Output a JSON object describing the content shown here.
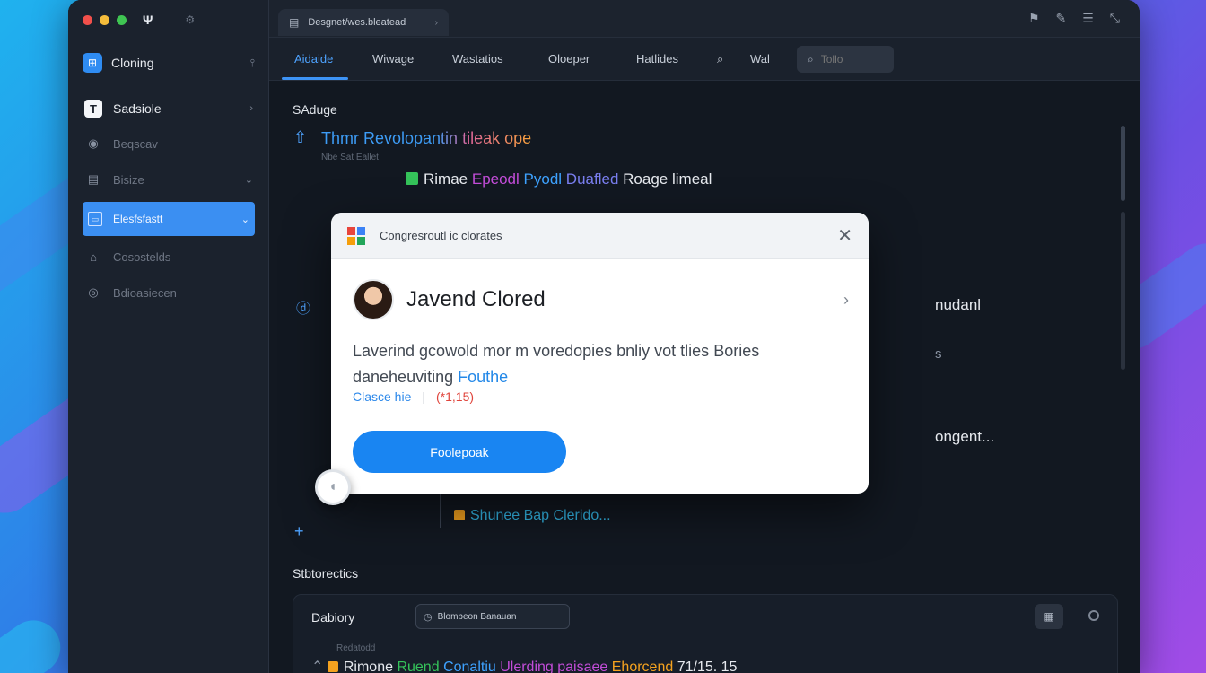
{
  "window": {
    "title_short": "Ψ",
    "doc_tab": "Desgnet/wes.bleatead"
  },
  "sidebar": {
    "app_name": "Cloning",
    "items": [
      {
        "label": "Sadsiole",
        "icon": "document-icon",
        "chevron": "›"
      },
      {
        "label": "Beqscav",
        "icon": "user-icon",
        "chevron": ""
      },
      {
        "label": "Bisize",
        "icon": "layout-icon",
        "chevron": "⌄"
      },
      {
        "label": "Elesfsfastt",
        "icon": "folder-icon",
        "chevron": "⌄"
      },
      {
        "label": "Cosostelds",
        "icon": "home-icon",
        "chevron": ""
      },
      {
        "label": "Bdioasiecen",
        "icon": "globe-icon",
        "chevron": ""
      }
    ]
  },
  "menubar": {
    "items": [
      "Aidaide",
      "Wiwage",
      "Wastatios",
      "Oloeper",
      "Hatlides"
    ],
    "extra_label": "Wal",
    "search_placeholder": "Tollo"
  },
  "content": {
    "section_title": "SAduge",
    "tree": {
      "line1": "Thmr Revolopantin tileak ope",
      "line1_sub": "Nbe Sat Eallet",
      "line2_a": "Rimae",
      "line2_b": "Epeodl",
      "line2_c": "Pyodl",
      "line2_d": "Duafled",
      "line2_e": "Roage",
      "line2_f": "limeal",
      "right_text_1": "nudanl",
      "right_text_2": "s",
      "right_text_3": "ongent...",
      "line_last": "Shunee Bap Clerido..."
    },
    "section2_title": "Stbtorectics",
    "bottom_panel": {
      "title": "Dabiory",
      "chip_label": "Blombeon Banauan",
      "row_meta": "Redatodd",
      "row_text_a": "Rimone",
      "row_text_b": "Ruend",
      "row_text_c": "Conaltiu",
      "row_text_d": "Ulerding paisaee",
      "row_text_e": "Ehorcend",
      "row_value": "71/15. 15"
    }
  },
  "modal": {
    "title": "Congresroutl ic clorates",
    "name": "Javend Clored",
    "body": "Laverind gcowold mor m voredopies bnliy vot tlies Bories",
    "body_line2": "daneheuviting",
    "body_link": "Fouthe",
    "meta_link": "Clasce hie",
    "meta_sep": "|",
    "meta_code": "(*1,15)",
    "button_label": "Foolepoak"
  },
  "colors": {
    "accent": "#3b8ff2",
    "modal_button": "#1985f2",
    "green": "#35c35a",
    "orange": "#f4a21f",
    "magenta": "#c34dd9"
  }
}
